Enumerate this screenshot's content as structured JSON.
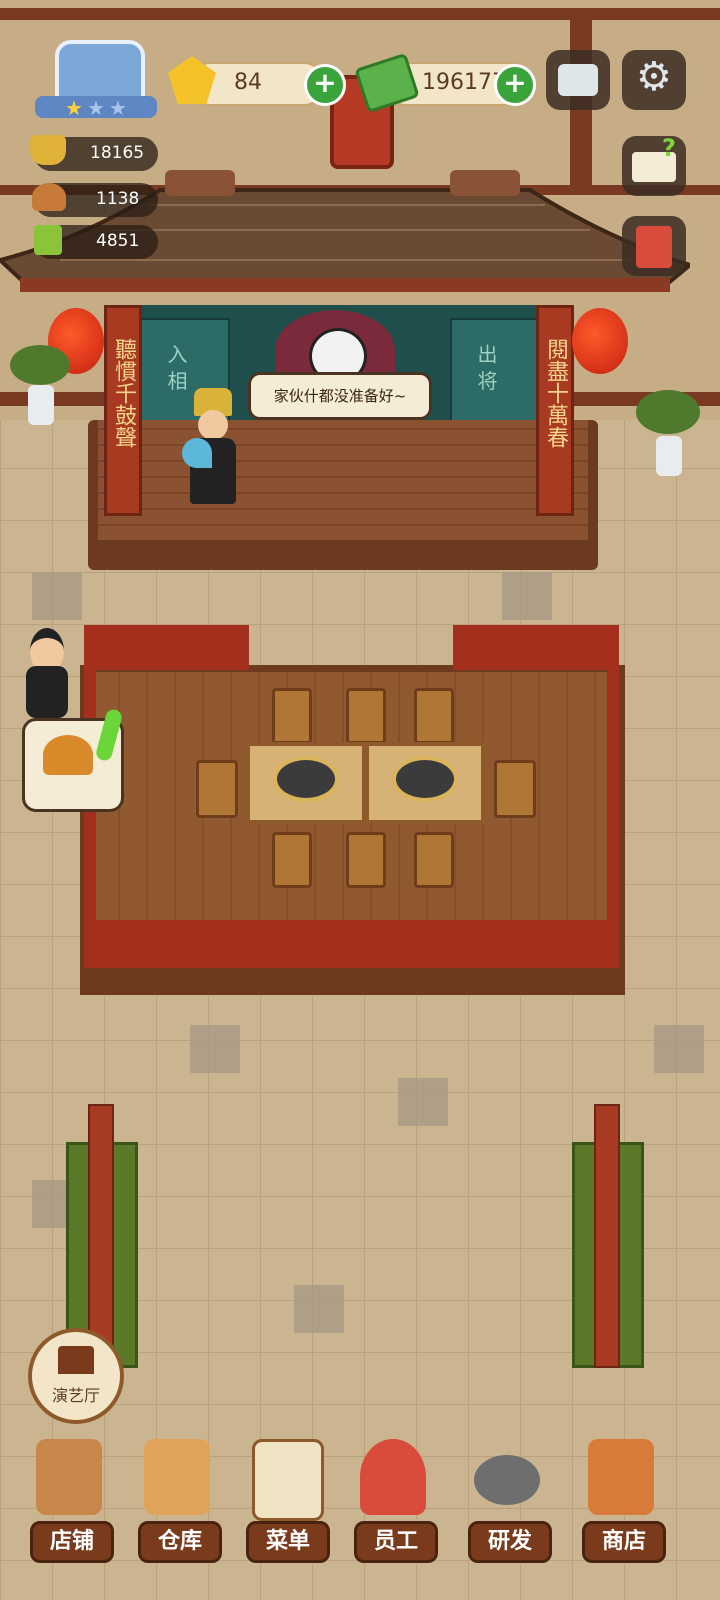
{
  "hud": {
    "gems": "84",
    "cash": "196177",
    "plus_label": "+",
    "resources": [
      {
        "icon": "gold-ingot-icon",
        "value": "18165"
      },
      {
        "icon": "food-dish-icon",
        "value": "1138"
      },
      {
        "icon": "green-book-icon",
        "value": "4851"
      }
    ],
    "rating_stars": 1,
    "rating_max": 3
  },
  "stage": {
    "couplet_left": "聽慣千鼓聲",
    "couplet_right": "閱盡十萬春",
    "curtain_left": "入 相",
    "curtain_right": "出 将",
    "speech": "家伙什都没准备好~"
  },
  "theater_button": {
    "label": "演艺厅",
    "icon": "theater-building-icon"
  },
  "nav": [
    {
      "label": "店铺",
      "icon": "shop-building-icon"
    },
    {
      "label": "仓库",
      "icon": "boxes-icon"
    },
    {
      "label": "菜单",
      "icon": "clipboard-menu-icon"
    },
    {
      "label": "员工",
      "icon": "waitress-icon"
    },
    {
      "label": "研发",
      "icon": "wok-icon"
    },
    {
      "label": "商店",
      "icon": "store-icon"
    }
  ],
  "colors": {
    "accent_green": "#3aa43a",
    "wood": "#7a3a1c",
    "red_lacquer": "#a83a22"
  }
}
